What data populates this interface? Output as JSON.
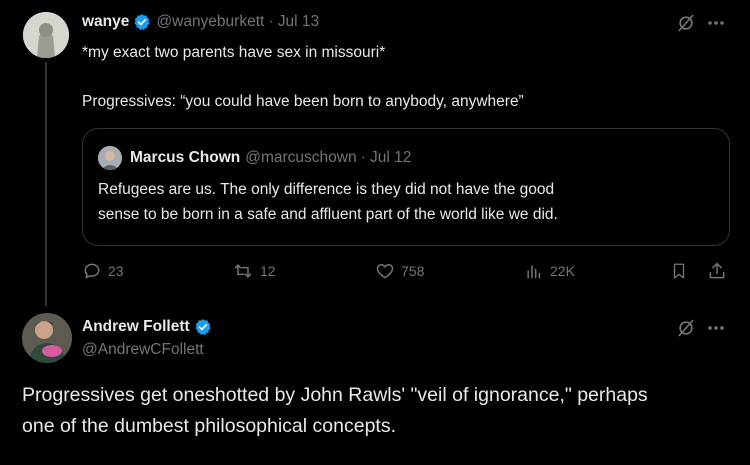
{
  "tweet1": {
    "name": "wanye",
    "handle": "@wanyeburkett",
    "date": "· Jul 13",
    "line1": "*my exact two parents have sex in missouri*",
    "line2": "Progressives: “you could have been born to anybody, anywhere”",
    "quote": {
      "name": "Marcus Chown",
      "handle": "@marcuschown",
      "date": "· Jul 12",
      "text_l1": "Refugees are us. The only difference is they did not have the good",
      "text_l2": "sense to be born in a safe and affluent part of the world like we did."
    },
    "actions": {
      "replies": "23",
      "reposts": "12",
      "likes": "758",
      "views": "22K"
    }
  },
  "tweet2": {
    "name": "Andrew Follett",
    "handle": "@AndrewCFollett",
    "text_l1": "Progressives get oneshotted by John Rawls' \"veil of ignorance,\" perhaps",
    "text_l2": "one of the dumbest philosophical concepts."
  },
  "colors": {
    "background": "#000000",
    "text": "#e7e9ea",
    "muted": "#71767b",
    "verified": "#1d9bf0",
    "border": "#2f3336"
  }
}
